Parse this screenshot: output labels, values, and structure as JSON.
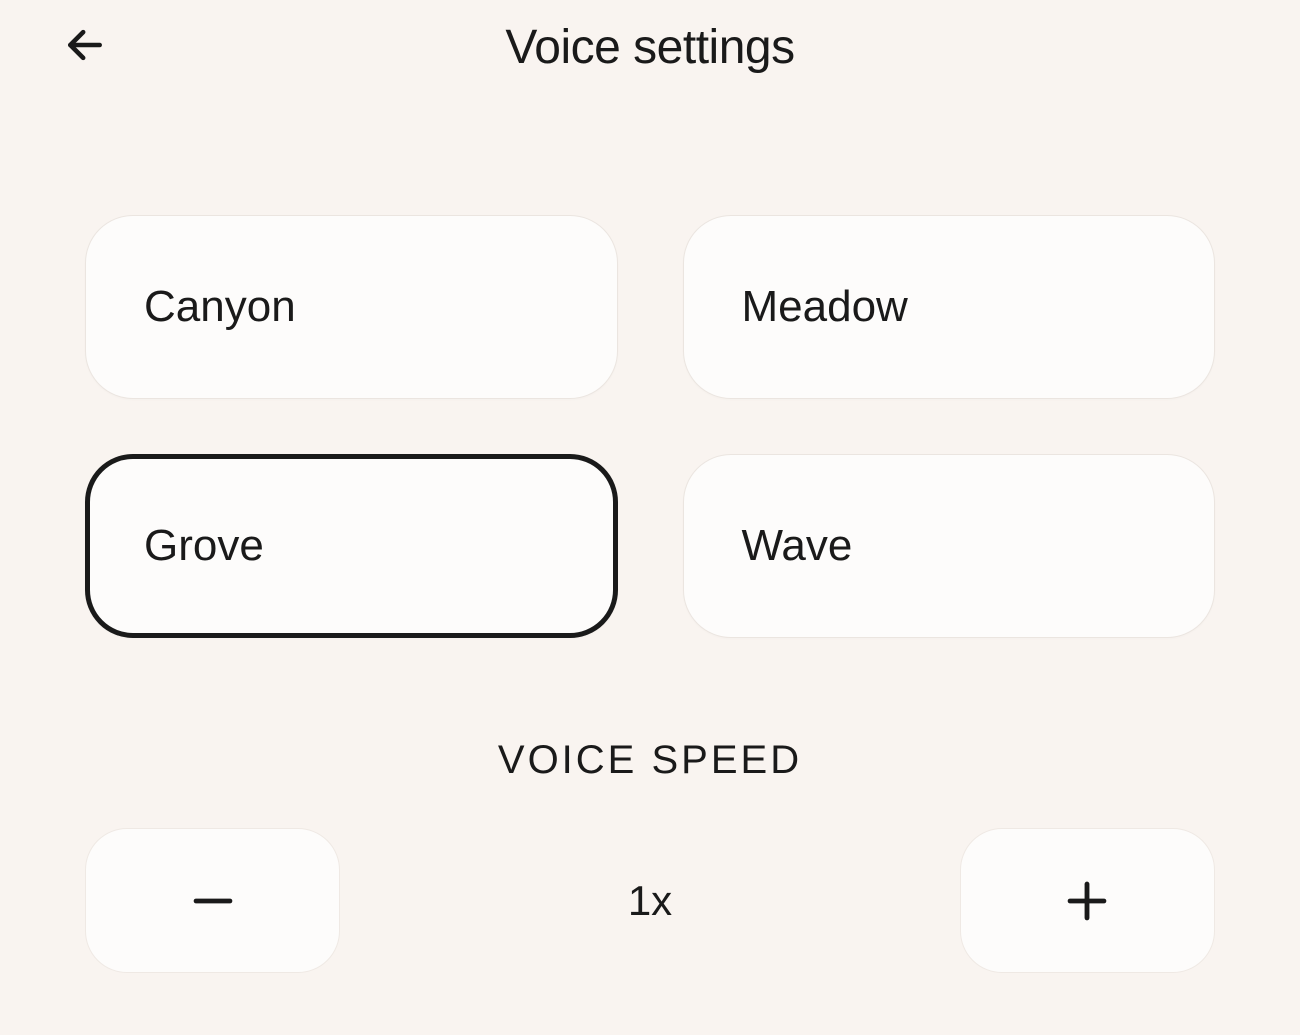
{
  "header": {
    "title": "Voice settings"
  },
  "voices": {
    "options": [
      {
        "label": "Canyon",
        "selected": false
      },
      {
        "label": "Meadow",
        "selected": false
      },
      {
        "label": "Grove",
        "selected": true
      },
      {
        "label": "Wave",
        "selected": false
      }
    ]
  },
  "speed": {
    "label": "VOICE SPEED",
    "value": "1x"
  }
}
